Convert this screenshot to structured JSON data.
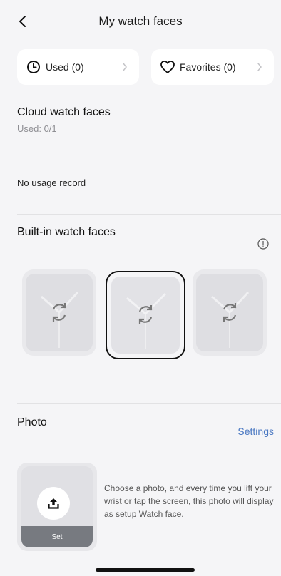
{
  "header": {
    "title": "My watch faces"
  },
  "chips": {
    "used_label": "Used (0)",
    "favorites_label": "Favorites (0)"
  },
  "cloud": {
    "title": "Cloud watch faces",
    "used": "Used: 0/1",
    "empty": "No usage record"
  },
  "builtin": {
    "title": "Built-in watch faces",
    "selected_index": 1,
    "faces": [
      {
        "icon": "sync-icon"
      },
      {
        "icon": "sync-icon"
      },
      {
        "icon": "sync-icon"
      }
    ]
  },
  "photo": {
    "title": "Photo",
    "settings_label": "Settings",
    "set_label": "Set",
    "description": "Choose a photo, and every time you lift your wrist or tap the screen, this photo will display as setup Watch face."
  },
  "colors": {
    "accent": "#4a78c2",
    "background": "#f5f5f7"
  }
}
